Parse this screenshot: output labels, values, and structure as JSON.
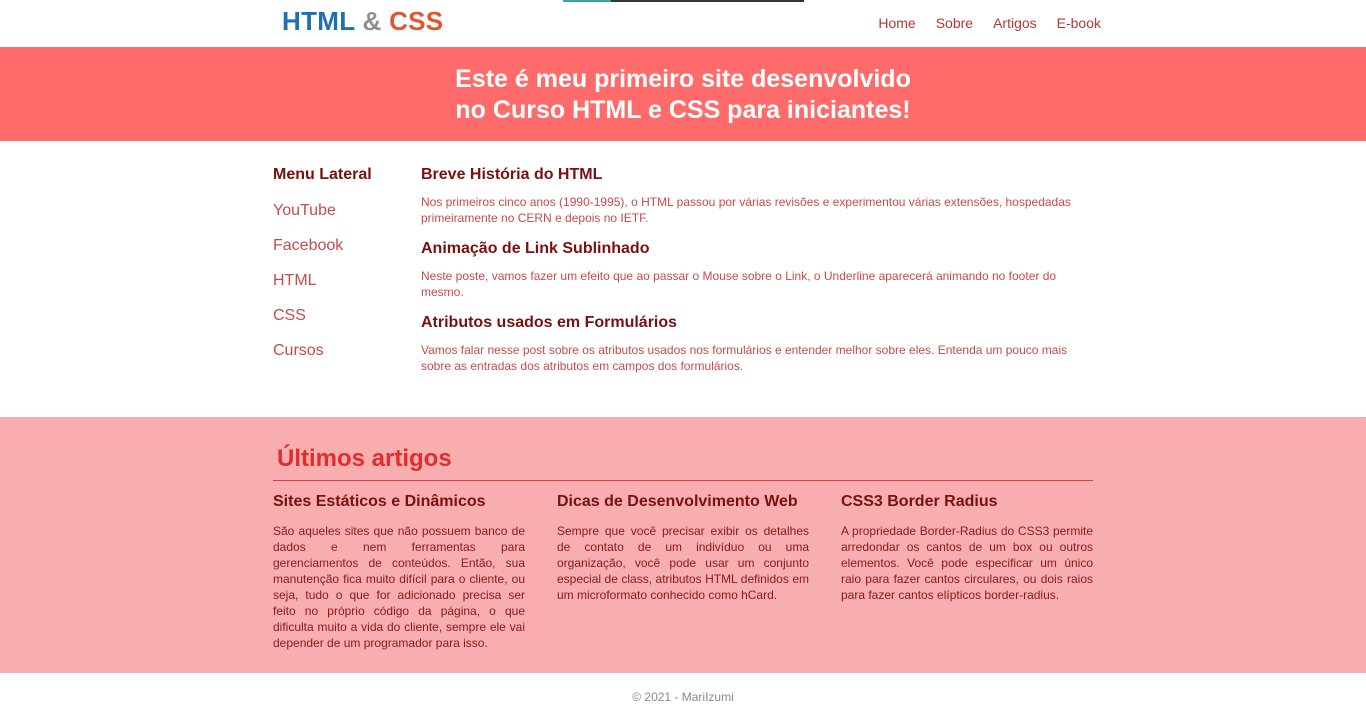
{
  "header": {
    "logo": {
      "part1": "HTML",
      "part2": "&",
      "part3": "CSS"
    },
    "nav": [
      {
        "label": "Home"
      },
      {
        "label": "Sobre"
      },
      {
        "label": "Artigos"
      },
      {
        "label": "E-book"
      }
    ]
  },
  "banner": {
    "line1": "Este é meu primeiro site desenvolvido",
    "line2": "no Curso HTML e CSS para iniciantes!"
  },
  "sidebar": {
    "title": "Menu Lateral",
    "items": [
      {
        "label": "YouTube"
      },
      {
        "label": "Facebook"
      },
      {
        "label": "HTML"
      },
      {
        "label": "CSS"
      },
      {
        "label": "Cursos"
      }
    ]
  },
  "articles": [
    {
      "title": "Breve História do HTML",
      "text": "Nos primeiros cinco anos (1990-1995), o HTML passou por várias revisões e experimentou várias extensões, hospedadas primeiramente no CERN e depois no IETF."
    },
    {
      "title": "Animação de Link Sublinhado",
      "text": "Neste poste, vamos fazer um efeito que ao passar o Mouse sobre o Link, o Underline aparecerá animando no footer do mesmo."
    },
    {
      "title": "Atributos usados em Formulários",
      "text": "Vamos falar nesse post sobre os atributos usados nos formulários e entender melhor sobre eles. Entenda um pouco mais sobre as entradas dos atributos em campos dos formulários."
    }
  ],
  "latest": {
    "title": "Últimos artigos",
    "columns": [
      {
        "title": "Sites Estáticos e Dinâmicos",
        "text": "São aqueles sites que não possuem banco de dados e nem ferramentas para gerenciamentos de conteúdos. Então, sua manutenção fica muito difícil para o cliente, ou seja, tudo o que for adicionado precisa ser feito no próprio código da página, o que dificulta muito a vida do cliente, sempre ele vai depender de um programador para isso."
      },
      {
        "title": "Dicas de Desenvolvimento Web",
        "text": "Sempre que você precisar exibir os detalhes de contato de um indivíduo ou uma organização, você pode usar um conjunto especial de class, atributos HTML definidos em um microformato conhecido como hCard."
      },
      {
        "title": "CSS3 Border Radius",
        "text": "A propriedade Border-Radius do CSS3 permite arredondar os cantos de um box ou outros elementos. Você pode especificar um único raio para fazer cantos circulares, ou dois raios para fazer cantos elípticos border-radius."
      }
    ]
  },
  "footer": {
    "copyright": "© 2021 - MariIzumi"
  }
}
